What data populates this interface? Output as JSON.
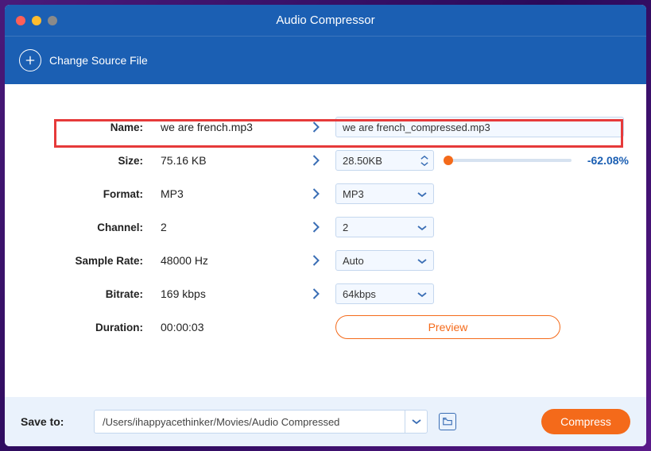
{
  "window": {
    "title": "Audio Compressor"
  },
  "toolbar": {
    "change_source": "Change Source File"
  },
  "rows": {
    "name": {
      "label": "Name:",
      "orig": "we are french.mp3",
      "out": "we are french_compressed.mp3"
    },
    "size": {
      "label": "Size:",
      "orig": "75.16 KB",
      "out": "28.50KB",
      "percent": "-62.08%"
    },
    "format": {
      "label": "Format:",
      "orig": "MP3",
      "out": "MP3"
    },
    "channel": {
      "label": "Channel:",
      "orig": "2",
      "out": "2"
    },
    "samplerate": {
      "label": "Sample Rate:",
      "orig": "48000 Hz",
      "out": "Auto"
    },
    "bitrate": {
      "label": "Bitrate:",
      "orig": "169 kbps",
      "out": "64kbps"
    },
    "duration": {
      "label": "Duration:",
      "orig": "00:00:03"
    }
  },
  "buttons": {
    "preview": "Preview",
    "compress": "Compress"
  },
  "footer": {
    "saveto_label": "Save to:",
    "path": "/Users/ihappyacethinker/Movies/Audio Compressed"
  }
}
